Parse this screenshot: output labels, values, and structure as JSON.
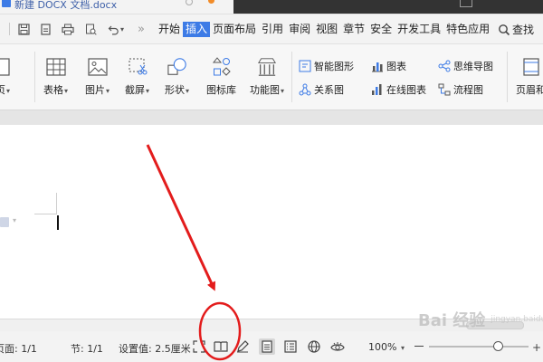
{
  "window": {
    "doc_tab_label": "新建 DOCX 文档.docx"
  },
  "menu": {
    "items": [
      "开始",
      "插入",
      "页面布局",
      "引用",
      "审阅",
      "视图",
      "章节",
      "安全",
      "开发工具",
      "特色应用"
    ],
    "active": "插入",
    "search_label": "查找"
  },
  "ribbon": {
    "page_label": "页",
    "table_label": "表格",
    "picture_label": "图片",
    "screenshot_label": "截屏",
    "shape_label": "形状",
    "icon_library_label": "图标库",
    "function_chart_label": "功能图",
    "smart_shape_label": "智能图形",
    "chart_label": "图表",
    "relation_chart_label": "关系图",
    "online_chart_label": "在线图表",
    "mind_map_label": "思维导图",
    "flowchart_label": "流程图",
    "header_footer_label": "页眉和"
  },
  "status": {
    "page_text": "页面: 1/1",
    "section_text": "节: 1/1",
    "setting_text": "设置值: 2.5厘米",
    "zoom_text": "100%",
    "zoom_level_percent": 100
  },
  "watermark": {
    "text": "Bai 经验",
    "sub": "jingyan.baidu.com"
  },
  "colors": {
    "accent": "#3d7be6",
    "annotation": "#e31c1c"
  }
}
